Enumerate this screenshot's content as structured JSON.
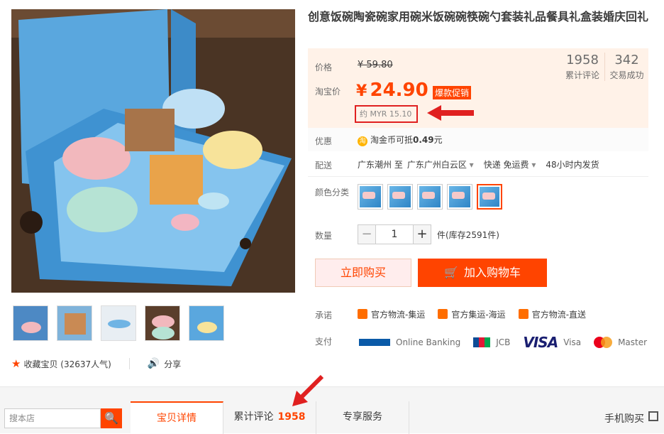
{
  "product": {
    "title": "创意饭碗陶瓷碗家用碗米饭碗碗筷碗勺套装礼品餐具礼盒装婚庆回礼"
  },
  "price": {
    "label_price": "价格",
    "original": "¥ 59.80",
    "label_taobao": "淘宝价",
    "currency": "¥",
    "value": "24.90",
    "promo_tag": "爆款促销",
    "myr": "约 MYR 15.10"
  },
  "stats": [
    {
      "number": "1958",
      "label": "累计评论"
    },
    {
      "number": "342",
      "label": "交易成功"
    }
  ],
  "promo": {
    "label": "优惠",
    "coin_icon": "淘",
    "text_prefix": "淘金币可抵",
    "amount": "0.49",
    "text_suffix": "元"
  },
  "shipping": {
    "label": "配送",
    "from": "广东潮州 至",
    "to": "广东广州白云区",
    "method": "快递 免运费",
    "dispatch": "48小时内发货"
  },
  "color": {
    "label": "颜色分类"
  },
  "quantity": {
    "label": "数量",
    "minus": "−",
    "value": "1",
    "plus": "+",
    "stock": "件(库存2591件)"
  },
  "actions": {
    "buy_now": "立即购买",
    "add_cart": "加入购物车",
    "cart_icon": "🛒"
  },
  "promise": {
    "label": "承诺",
    "items": [
      "官方物流-集运",
      "官方集运-海运",
      "官方物流-直送"
    ]
  },
  "payment": {
    "label": "支付",
    "online_banking": "Online Banking",
    "jcb": "JCB",
    "visa_logo": "VISA",
    "visa": "Visa",
    "master": "Master"
  },
  "fav": {
    "star": "★",
    "label": "收藏宝贝 (32637人气)",
    "share_icon": "🔊",
    "share": "分享"
  },
  "bottom": {
    "search_placeholder": "搜本店",
    "search_icon": "🔍",
    "tabs": [
      {
        "label": "宝贝详情"
      },
      {
        "label": "累计评论",
        "count": "1958"
      },
      {
        "label": "专享服务"
      }
    ],
    "mobile": "手机购买"
  },
  "colors": {
    "accent": "#ff4400",
    "annotation": "#e02020"
  }
}
